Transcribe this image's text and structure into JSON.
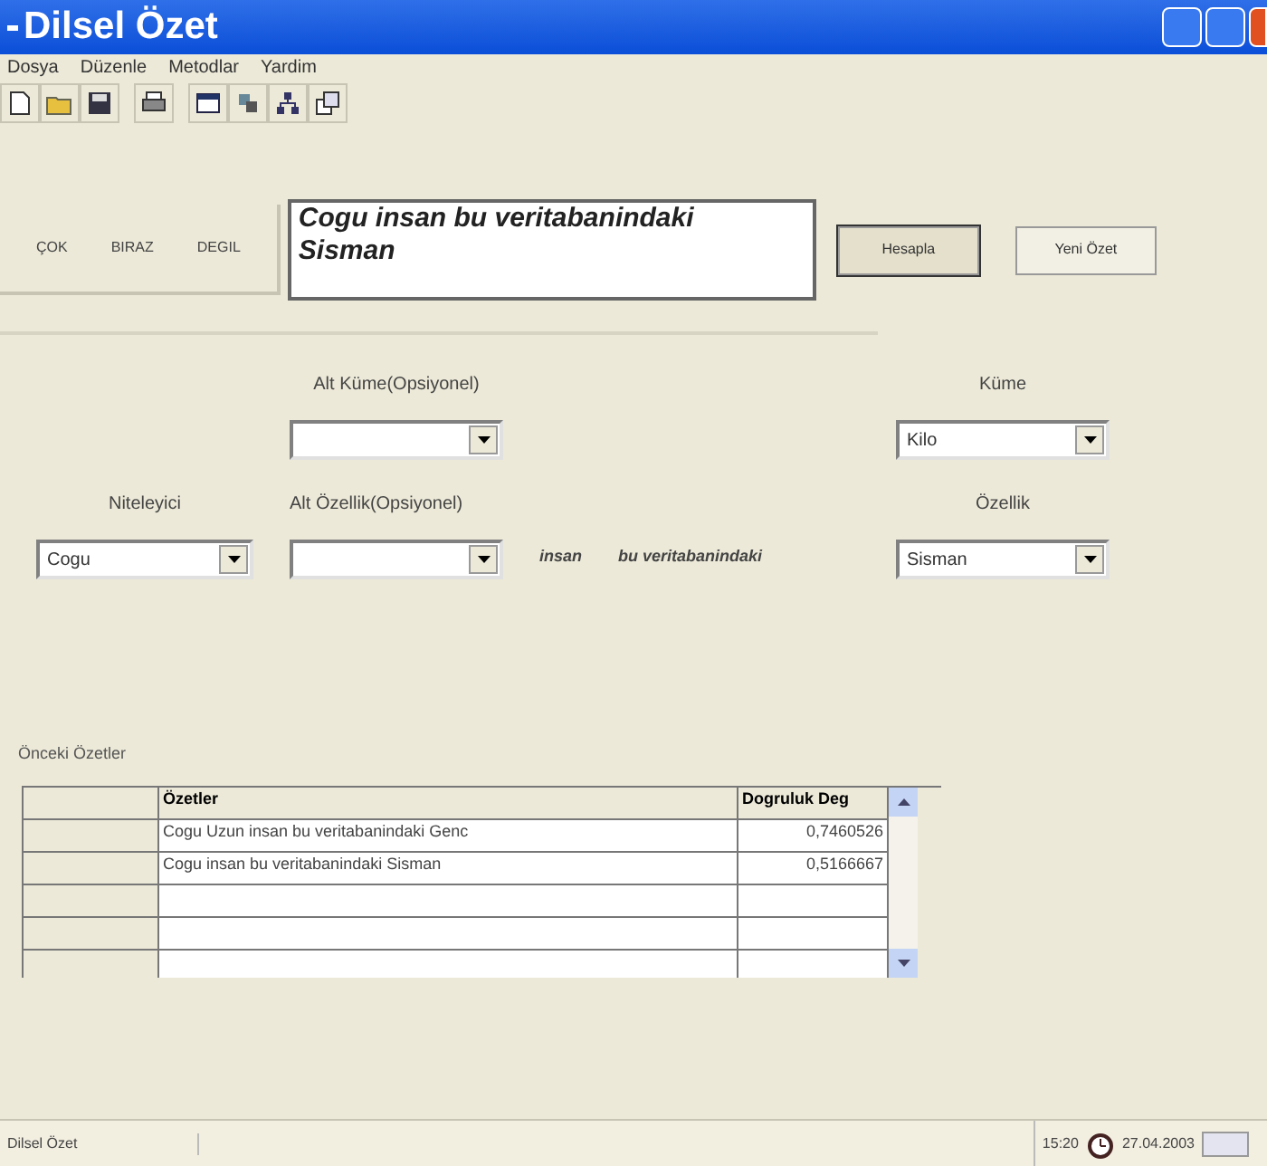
{
  "window": {
    "title": "Dilsel Özet"
  },
  "menu": [
    "Dosya",
    "Düzenle",
    "Metodlar",
    "Yardim"
  ],
  "toolbar": [
    {
      "kind": "new"
    },
    {
      "kind": "open"
    },
    {
      "kind": "save"
    },
    {
      "kind": "print"
    },
    {
      "kind": "window"
    },
    {
      "kind": "tools"
    },
    {
      "kind": "tree"
    },
    {
      "kind": "copy"
    }
  ],
  "quantifier_buttons": [
    "ÇOK",
    "BIRAZ",
    "DEGIL"
  ],
  "summary_text": [
    "Cogu insan bu veritabanindaki",
    "Sisman"
  ],
  "actions": [
    {
      "label": "Hesapla",
      "selected": true
    },
    {
      "label": "Yeni Özet",
      "selected": false
    }
  ],
  "form": {
    "alt_kume": {
      "label": "Alt Küme(Opsiyonel)"
    },
    "kume": {
      "label": "Küme",
      "value": "Kilo"
    },
    "niteleyici": {
      "label": "Niteleyici",
      "value": "Cogu"
    },
    "alt_ozellik": {
      "label": "Alt Özellik(Opsiyonel)"
    },
    "ozellik": {
      "label": "Özellik",
      "value": "Sisman"
    },
    "words": [
      "insan",
      "bu veritabanindaki"
    ]
  },
  "previous": {
    "label": "Önceki Özetler",
    "columns": [
      "Özetler",
      "Dogruluk Deg"
    ],
    "rows": [
      {
        "summary": "Cogu Uzun insan bu veritabanindaki Genc",
        "value": "0,7460526"
      },
      {
        "summary": "Cogu insan bu veritabanindaki Sisman",
        "value": "0,5166667"
      }
    ]
  },
  "status_bar": {
    "app": "Dilsel Özet",
    "time": "15:20",
    "date": "27.04.2003"
  }
}
